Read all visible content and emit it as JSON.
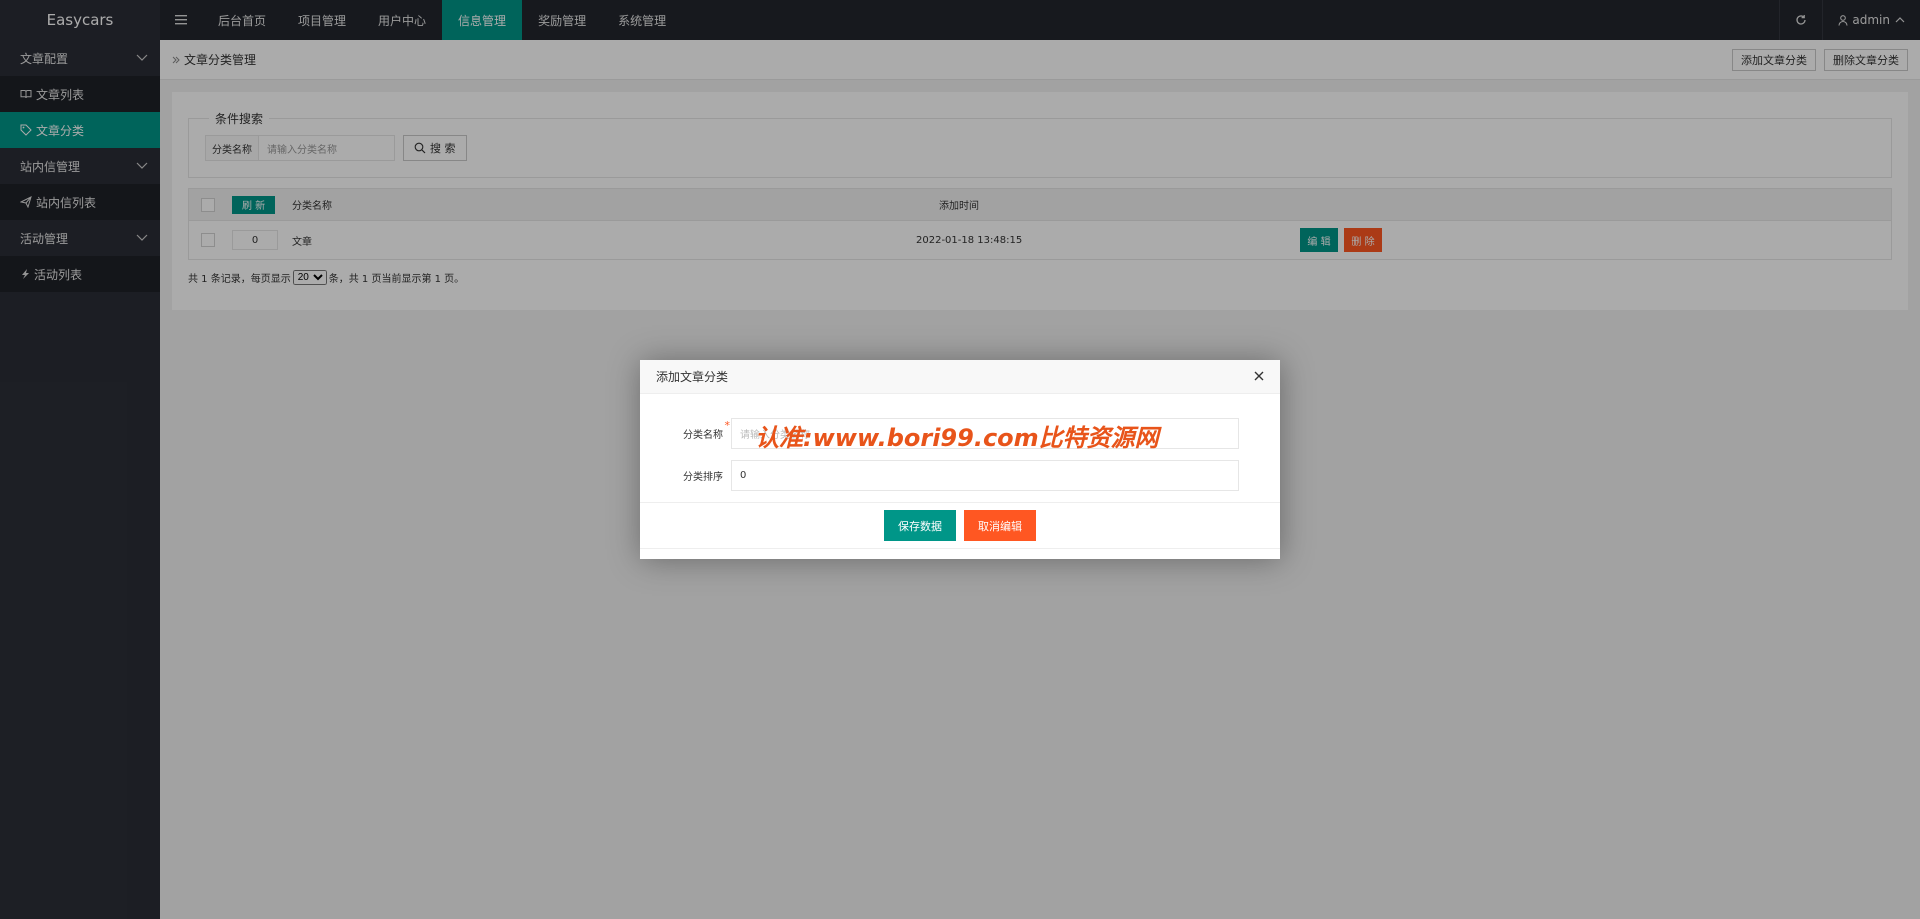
{
  "header": {
    "logo": "Easycars",
    "menu_icon": "menu-icon",
    "nav": [
      {
        "label": "后台首页"
      },
      {
        "label": "项目管理"
      },
      {
        "label": "用户中心"
      },
      {
        "label": "信息管理"
      },
      {
        "label": "奖励管理"
      },
      {
        "label": "系统管理"
      }
    ],
    "active_nav": "信息管理",
    "user": "admin"
  },
  "sidebar": {
    "groups": [
      {
        "label": "文章配置",
        "items": [
          {
            "label": "文章列表",
            "icon": "book-icon"
          },
          {
            "label": "文章分类",
            "icon": "tag-icon"
          }
        ]
      },
      {
        "label": "站内信管理",
        "items": [
          {
            "label": "站内信列表",
            "icon": "send-icon"
          }
        ]
      },
      {
        "label": "活动管理",
        "items": [
          {
            "label": "活动列表",
            "icon": "activity-icon"
          }
        ]
      }
    ],
    "active_item": "文章分类"
  },
  "breadcrumb": {
    "title": "文章分类管理",
    "add_button": "添加文章分类",
    "delete_button": "删除文章分类"
  },
  "search": {
    "legend": "条件搜索",
    "label": "分类名称",
    "placeholder": "请输入分类名称",
    "button": "搜 索"
  },
  "table": {
    "refresh_button": "刷 新",
    "columns": [
      "分类名称",
      "添加时间"
    ],
    "rows": [
      {
        "sort": "0",
        "name": "文章",
        "time": "2022-01-18 13:48:15",
        "edit": "编 辑",
        "delete": "删 除"
      }
    ]
  },
  "pager": {
    "prefix": "共 1 条记录，每页显示",
    "page_size": "20",
    "suffix": "条，共 1 页当前显示第 1 页。"
  },
  "modal": {
    "title": "添加文章分类",
    "name_label": "分类名称",
    "name_placeholder": "请输入分类名称",
    "sort_label": "分类排序",
    "sort_value": "0",
    "save_button": "保存数据",
    "cancel_button": "取消编辑"
  },
  "watermark": "认准:www.bori99.com比特资源网",
  "colors": {
    "accent": "#009688",
    "danger": "#ff5722",
    "header_bg": "#23262e",
    "sidebar_bg": "#2b2e37"
  }
}
